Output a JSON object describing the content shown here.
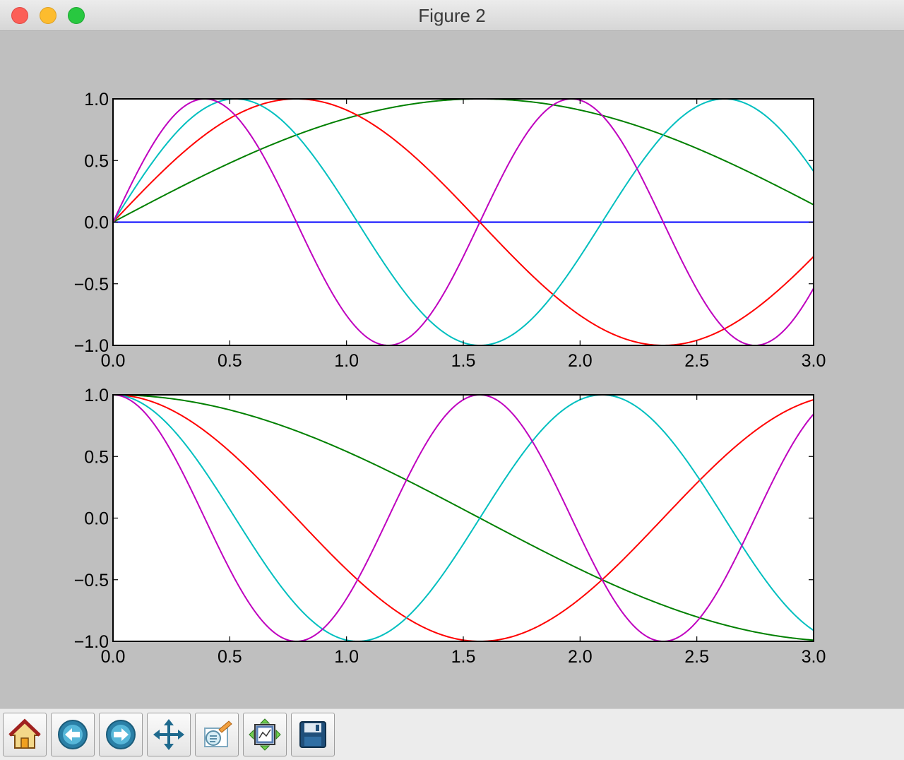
{
  "window": {
    "title": "Figure 2"
  },
  "toolbar": {
    "buttons": [
      {
        "name": "home-button",
        "icon": "home-icon"
      },
      {
        "name": "back-button",
        "icon": "back-arrow-icon"
      },
      {
        "name": "forward-button",
        "icon": "forward-arrow-icon"
      },
      {
        "name": "pan-button",
        "icon": "pan-move-icon"
      },
      {
        "name": "zoom-button",
        "icon": "zoom-rectangle-icon"
      },
      {
        "name": "subplots-button",
        "icon": "subplots-config-icon"
      },
      {
        "name": "save-button",
        "icon": "save-disk-icon"
      }
    ]
  },
  "chart_data": [
    {
      "type": "line",
      "title": "",
      "xlabel": "",
      "ylabel": "",
      "xlim": [
        0,
        3.0
      ],
      "ylim": [
        -1.0,
        1.0
      ],
      "xticks": [
        "0.0",
        "0.5",
        "1.0",
        "1.5",
        "2.0",
        "2.5",
        "3.0"
      ],
      "yticks": [
        "1.0",
        "0.5",
        "0.0",
        "−0.5",
        "−1.0"
      ],
      "x_range": [
        0,
        3.0
      ],
      "series": [
        {
          "function": "sin(0*x)",
          "color": "#0000ff"
        },
        {
          "function": "sin(1*x)",
          "color": "#008000"
        },
        {
          "function": "sin(2*x)",
          "color": "#ff0000"
        },
        {
          "function": "sin(3*x)",
          "color": "#00bfbf"
        },
        {
          "function": "sin(4*x)",
          "color": "#bf00bf"
        }
      ]
    },
    {
      "type": "line",
      "title": "",
      "xlabel": "",
      "ylabel": "",
      "xlim": [
        0,
        3.0
      ],
      "ylim": [
        -1.0,
        1.0
      ],
      "xticks": [
        "0.0",
        "0.5",
        "1.0",
        "1.5",
        "2.0",
        "2.5",
        "3.0"
      ],
      "yticks": [
        "1.0",
        "0.5",
        "0.0",
        "−0.5",
        "−1.0"
      ],
      "x_range": [
        0,
        3.0
      ],
      "series": [
        {
          "function": "cos(1*x)",
          "color": "#008000"
        },
        {
          "function": "cos(2*x)",
          "color": "#ff0000"
        },
        {
          "function": "cos(3*x)",
          "color": "#00bfbf"
        },
        {
          "function": "cos(4*x)",
          "color": "#bf00bf"
        }
      ]
    }
  ]
}
